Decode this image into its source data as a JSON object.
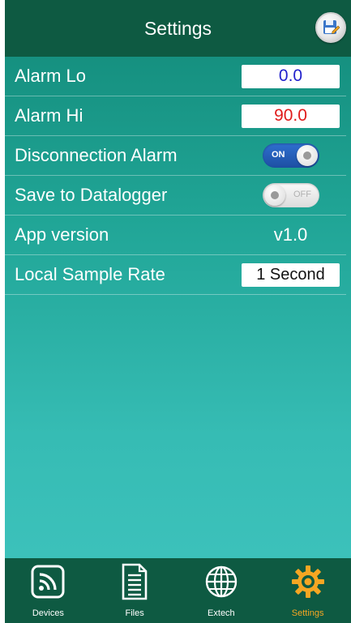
{
  "header": {
    "title": "Settings",
    "save_icon": "save-edit-icon"
  },
  "settings": {
    "alarm_lo": {
      "label": "Alarm Lo",
      "value": "0.0",
      "color": "#2222cc"
    },
    "alarm_hi": {
      "label": "Alarm Hi",
      "value": "90.0",
      "color": "#e01b1b"
    },
    "disconnection_alarm": {
      "label": "Disconnection Alarm",
      "state": "ON"
    },
    "save_to_datalogger": {
      "label": "Save to Datalogger",
      "state": "OFF"
    },
    "app_version": {
      "label": "App version",
      "value": "v1.0"
    },
    "local_sample_rate": {
      "label": "Local Sample Rate",
      "value": "1 Second"
    }
  },
  "tabs": [
    {
      "label": "Devices",
      "icon": "wireless-device-icon"
    },
    {
      "label": "Files",
      "icon": "file-document-icon"
    },
    {
      "label": "Extech",
      "icon": "globe-icon"
    },
    {
      "label": "Settings",
      "icon": "gear-icon",
      "active": true
    }
  ],
  "colors": {
    "header": "#0e5a42",
    "accent_active": "#f5a623",
    "toggle_on": "#1d4fa3"
  }
}
